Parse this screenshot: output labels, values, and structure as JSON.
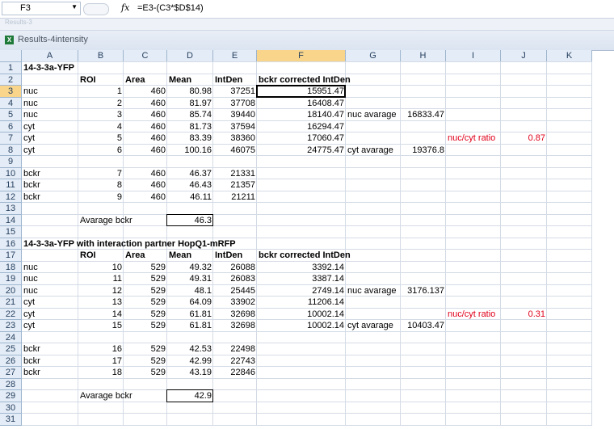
{
  "formula_bar": {
    "name_box": "F3",
    "fx": "fx",
    "formula": "=E3-(C3*$D$14)"
  },
  "ghost_window": {
    "title": "Results-3"
  },
  "window": {
    "title": "Results-4intensity"
  },
  "columns": [
    "A",
    "B",
    "C",
    "D",
    "E",
    "F",
    "G",
    "H",
    "I",
    "J",
    "K"
  ],
  "rows": [
    {
      "n": "1",
      "A": "14-3-3a-YFP"
    },
    {
      "n": "2",
      "B": "ROI",
      "C": "Area",
      "D": "Mean",
      "E": "IntDen",
      "F": "bckr corrected IntDen"
    },
    {
      "n": "3",
      "A": "nuc",
      "B": "1",
      "C": "460",
      "D": "80.98",
      "E": "37251",
      "F": "15951.47"
    },
    {
      "n": "4",
      "A": "nuc",
      "B": "2",
      "C": "460",
      "D": "81.97",
      "E": "37708",
      "F": "16408.47"
    },
    {
      "n": "5",
      "A": "nuc",
      "B": "3",
      "C": "460",
      "D": "85.74",
      "E": "39440",
      "F": "18140.47",
      "G": "nuc avarage",
      "H": "16833.47"
    },
    {
      "n": "6",
      "A": "cyt",
      "B": "4",
      "C": "460",
      "D": "81.73",
      "E": "37594",
      "F": "16294.47"
    },
    {
      "n": "7",
      "A": "cyt",
      "B": "5",
      "C": "460",
      "D": "83.39",
      "E": "38360",
      "F": "17060.47",
      "I": "nuc/cyt ratio",
      "J": "0.87"
    },
    {
      "n": "8",
      "A": "cyt",
      "B": "6",
      "C": "460",
      "D": "100.16",
      "E": "46075",
      "F": "24775.47",
      "G": "cyt avarage",
      "H": "19376.8"
    },
    {
      "n": "9"
    },
    {
      "n": "10",
      "A": "bckr",
      "B": "7",
      "C": "460",
      "D": "46.37",
      "E": "21331"
    },
    {
      "n": "11",
      "A": "bckr",
      "B": "8",
      "C": "460",
      "D": "46.43",
      "E": "21357"
    },
    {
      "n": "12",
      "A": "bckr",
      "B": "9",
      "C": "460",
      "D": "46.11",
      "E": "21211"
    },
    {
      "n": "13"
    },
    {
      "n": "14",
      "B": "Avarage bckr",
      "D": "46.3"
    },
    {
      "n": "15"
    },
    {
      "n": "16",
      "A": "14-3-3a-YFP with interaction partner HopQ1-mRFP"
    },
    {
      "n": "17",
      "B": "ROI",
      "C": "Area",
      "D": "Mean",
      "E": "IntDen",
      "F": "bckr corrected IntDen"
    },
    {
      "n": "18",
      "A": "nuc",
      "B": "10",
      "C": "529",
      "D": "49.32",
      "E": "26088",
      "F": "3392.14"
    },
    {
      "n": "19",
      "A": "nuc",
      "B": "11",
      "C": "529",
      "D": "49.31",
      "E": "26083",
      "F": "3387.14"
    },
    {
      "n": "20",
      "A": "nuc",
      "B": "12",
      "C": "529",
      "D": "48.1",
      "E": "25445",
      "F": "2749.14",
      "G": "nuc avarage",
      "H": "3176.137"
    },
    {
      "n": "21",
      "A": "cyt",
      "B": "13",
      "C": "529",
      "D": "64.09",
      "E": "33902",
      "F": "11206.14"
    },
    {
      "n": "22",
      "A": "cyt",
      "B": "14",
      "C": "529",
      "D": "61.81",
      "E": "32698",
      "F": "10002.14",
      "I": "nuc/cyt ratio",
      "J": "0.31"
    },
    {
      "n": "23",
      "A": "cyt",
      "B": "15",
      "C": "529",
      "D": "61.81",
      "E": "32698",
      "F": "10002.14",
      "G": "cyt avarage",
      "H": "10403.47"
    },
    {
      "n": "24"
    },
    {
      "n": "25",
      "A": "bckr",
      "B": "16",
      "C": "529",
      "D": "42.53",
      "E": "22498"
    },
    {
      "n": "26",
      "A": "bckr",
      "B": "17",
      "C": "529",
      "D": "42.99",
      "E": "22743"
    },
    {
      "n": "27",
      "A": "bckr",
      "B": "18",
      "C": "529",
      "D": "43.19",
      "E": "22846"
    },
    {
      "n": "28"
    },
    {
      "n": "29",
      "B": "Avarage bckr",
      "D": "42.9"
    },
    {
      "n": "30"
    },
    {
      "n": "31"
    }
  ],
  "selected_cell": "F3",
  "colors": {
    "header_bg": "#e4ecf7",
    "selected_header": "#f8d58a",
    "ratio_red": "#e0001a"
  }
}
